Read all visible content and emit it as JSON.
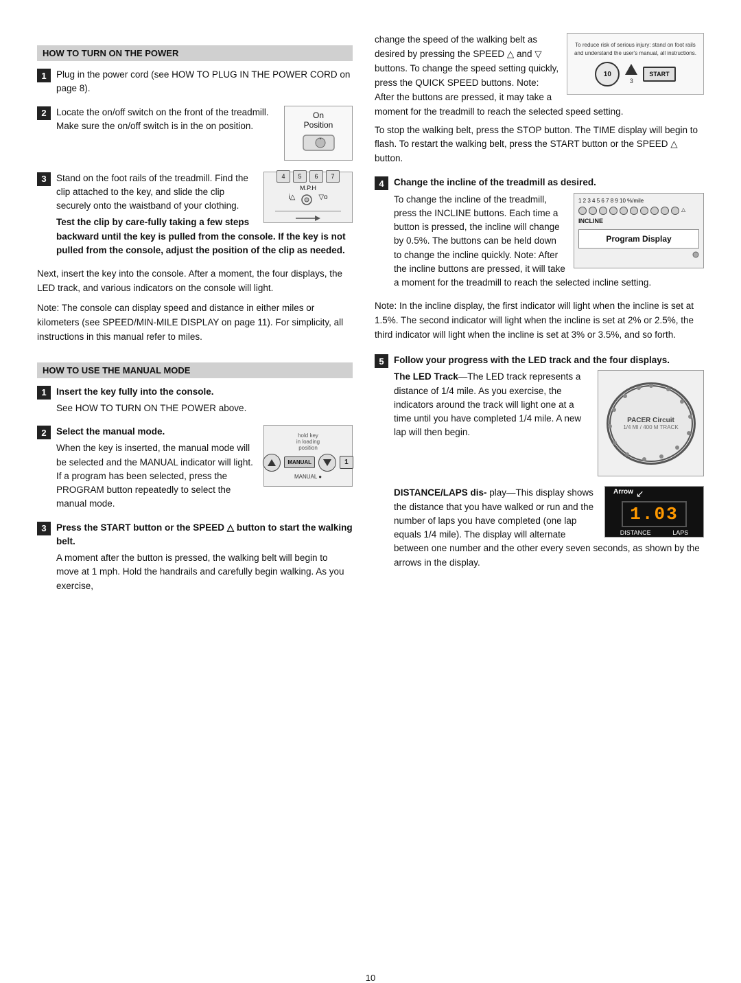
{
  "page": {
    "number": "10"
  },
  "left_col": {
    "section1": {
      "header": "HOW TO TURN ON THE POWER",
      "step1": {
        "num": "1",
        "text": "Plug in the power cord (see HOW TO PLUG IN THE POWER CORD on page 8)."
      },
      "step2": {
        "num": "2",
        "text1": "Locate the on/off switch on the front of the treadmill. Make sure the on/off switch is in the on position.",
        "fig_label1": "On",
        "fig_label2": "Position"
      },
      "step3": {
        "num": "3",
        "text1": "Stand on the foot rails of the treadmill. Find the clip attached to the key, and slide the clip securely onto the waistband of your clothing.",
        "bold_text": "Test the clip by care-fully taking a few steps backward until the key is pulled from the console. If the key is not pulled from the console, adjust the position of the clip as needed.",
        "fig_mph": "M.P.H"
      },
      "note": "Next, insert the key into the console. After a moment, the four displays, the LED track, and various indicators on the console will light.",
      "note2": "Note: The console can display speed and distance in either miles or kilometers (see SPEED/MIN-MILE DISPLAY on page 11). For simplicity, all instructions in this manual refer to miles."
    },
    "section2": {
      "header": "HOW TO USE THE MANUAL MODE",
      "step1": {
        "num": "1",
        "bold_text": "Insert the key fully into the console.",
        "text": "See HOW TO TURN ON THE POWER above."
      },
      "step2": {
        "num": "2",
        "bold_text": "Select the manual mode.",
        "text": "When the key is inserted, the manual mode will be selected and the MANUAL indicator will light. If a program has been selected, press the PROGRAM button repeatedly to select the manual mode.",
        "fig_manual_label": "MANUAL"
      },
      "step3": {
        "num": "3",
        "bold_text": "Press the START button or the SPEED △ button to start the walking belt.",
        "text": "A moment after the button is pressed, the walking belt will begin to move at 1 mph. Hold the handrails and carefully begin walking. As you exercise,"
      }
    }
  },
  "right_col": {
    "intro_text": "change the speed of the walking belt as desired by pressing the SPEED △ and ▽ buttons. To change the speed setting quickly, press the QUICK SPEED buttons. Note: After the buttons are pressed, it may take a moment for the treadmill to reach the selected speed setting.",
    "stop_text": "To stop the walking belt, press the STOP button. The TIME display will begin to flash. To restart the walking belt, press the START button or the SPEED △ button.",
    "step4": {
      "num": "4",
      "bold_text": "Change the incline of the treadmill as desired.",
      "text1": "To change the incline of the treadmill, press the INCLINE buttons. Each time a button is pressed, the incline will change by 0.5%. The buttons can be held down to change the incline quickly. Note: After the incline buttons are pressed, it will take a moment for the treadmill to reach the selected incline setting.",
      "fig_program_display": "Program Display",
      "note_incline": "Note: In the incline display, the first indicator will light when the incline is set at 1.5%. The second indicator will light when the incline is set at 2% or 2.5%, the third indicator will light when the incline is set at 3% or 3.5%, and so forth."
    },
    "step5": {
      "num": "5",
      "bold_text": "Follow your progress with the LED track and the four displays.",
      "led_track_label": "The LED Track",
      "led_track_text": "The LED track represents a distance of 1/4 mile. As you exercise, the indicators around the track will light one at a time until you have completed 1/4 mile. A new lap will then begin.",
      "led_brand": "PACER Circuit",
      "led_sub": "1/4 MI / 400 M TRACK",
      "distance_label": "DISTANCE/LAPS dis-",
      "distance_text": "play—This display shows the distance that you have walked or run and the number of laps you have completed (one lap equals 1/4 mile). The display will alternate between one number and the other every seven seconds, as shown by the arrows in the display.",
      "arrow_label": "Arrow",
      "dist_value": "1.03",
      "dist_label1": "DISTANCE",
      "dist_label2": "LAPS"
    },
    "fig_warning": {
      "warning_text": "To reduce risk of serious injury: stand on foot rails and understand the user's manual, all instructions.",
      "btn_10": "10",
      "btn_3": "3",
      "btn_start": "START"
    }
  }
}
